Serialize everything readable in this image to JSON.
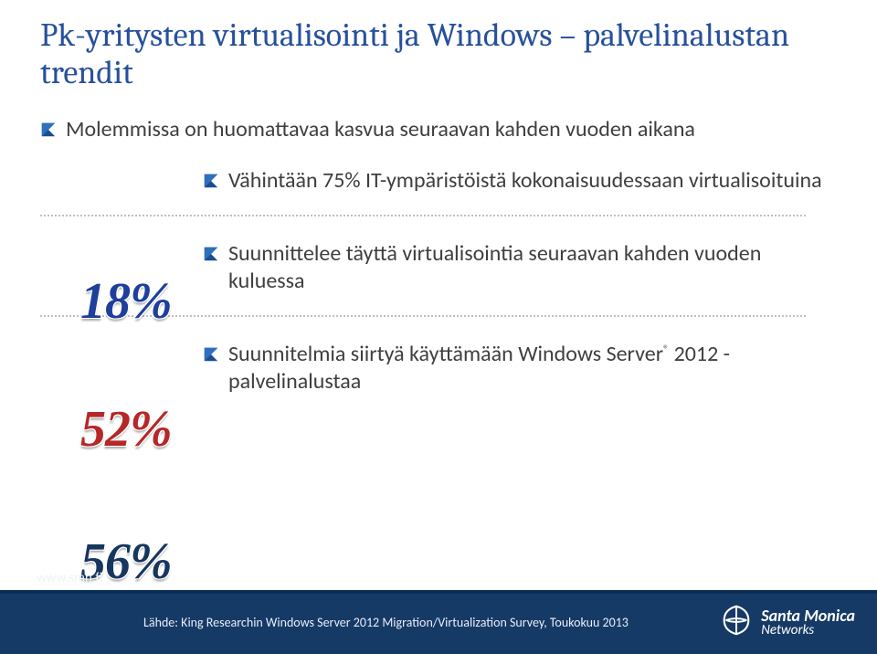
{
  "title": "Pk-yritysten virtualisointi ja Windows – palvelinalustan trendit",
  "intro": "Molemmissa on huomattavaa kasvua seuraavan kahden vuoden aikana",
  "stats": {
    "s1": {
      "pct": "18%",
      "text": "Vähintään 75% IT-ympäristöistä kokonaisuudessaan virtualisoituina"
    },
    "s2": {
      "pct": "52%",
      "text": "Suunnittelee täyttä virtualisointia seuraavan kahden vuoden kuluessa"
    },
    "s3": {
      "pct": "56%",
      "text_a": "Suunnitelmia siirtyä käyttämään Windows Server",
      "reg": "®",
      "text_b": " 2012 -palvelinalustaa"
    }
  },
  "footer": {
    "url": "www.smn.fi",
    "source": "Lähde: King Researchin Windows Server 2012 Migration/Virtualization Survey, Toukokuu 2013",
    "brand_line1": "Santa",
    "brand_line2": "Monica",
    "brand_line3": "Networks"
  }
}
